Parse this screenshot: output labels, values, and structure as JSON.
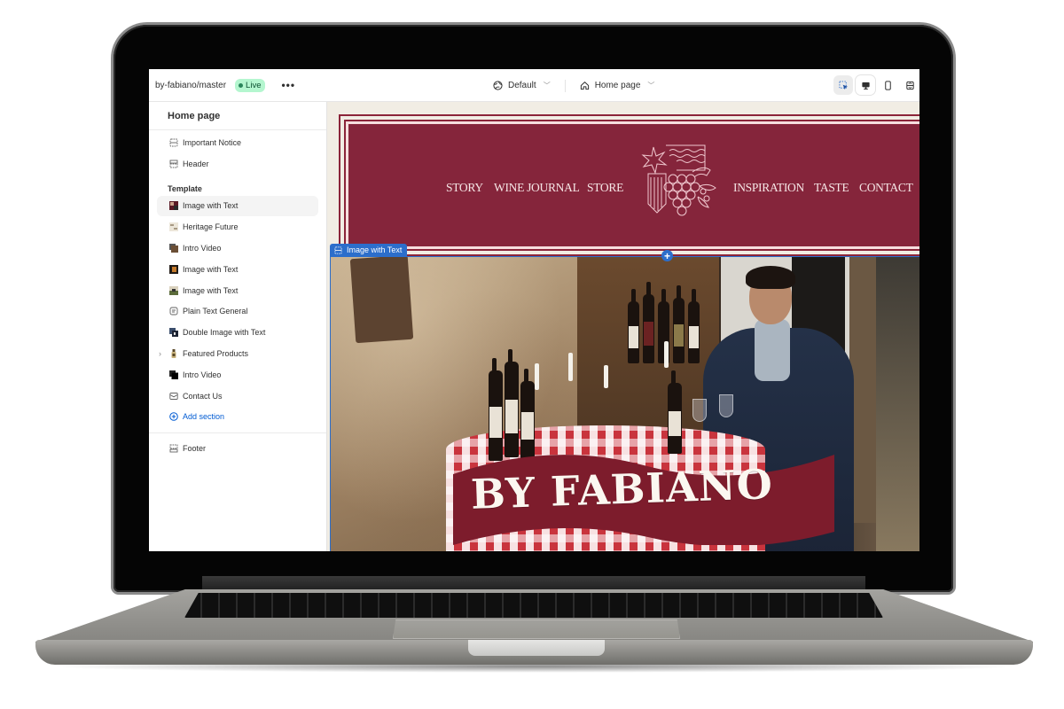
{
  "topbar": {
    "branch": "by-fabiano/master",
    "status_badge": "Live",
    "more_label": "•••",
    "theme_selector": {
      "value": "Default",
      "icon": "globe-icon"
    },
    "page_selector": {
      "value": "Home page",
      "icon": "home-icon"
    },
    "tools": [
      {
        "name": "inspector",
        "icon": "cursor-select-icon",
        "active": true
      },
      {
        "name": "desktop-view",
        "icon": "desktop-icon",
        "active": true
      },
      {
        "name": "mobile-view",
        "icon": "mobile-icon",
        "active": false
      },
      {
        "name": "fullscreen-view",
        "icon": "expand-icon",
        "active": false
      }
    ]
  },
  "sidebar": {
    "title": "Home page",
    "header_items": [
      {
        "label": "Important Notice",
        "icon": "section-icon"
      },
      {
        "label": "Header",
        "icon": "header-icon"
      }
    ],
    "template_label": "Template",
    "template_items": [
      {
        "label": "Image with Text",
        "icon": "thumbnail-icon",
        "selected": true
      },
      {
        "label": "Heritage Future",
        "icon": "thumbnail-icon"
      },
      {
        "label": "Intro Video",
        "icon": "video-icon"
      },
      {
        "label": "Image with Text",
        "icon": "thumbnail-icon"
      },
      {
        "label": "Image with Text",
        "icon": "thumbnail-icon"
      },
      {
        "label": "Plain Text General",
        "icon": "text-icon"
      },
      {
        "label": "Double Image with Text",
        "icon": "thumbnail-icon"
      },
      {
        "label": "Featured Products",
        "icon": "product-icon",
        "expandable": true
      },
      {
        "label": "Intro Video",
        "icon": "video-icon"
      },
      {
        "label": "Contact Us",
        "icon": "mail-icon"
      }
    ],
    "add_section_label": "Add section",
    "footer_items": [
      {
        "label": "Footer",
        "icon": "footer-icon"
      }
    ]
  },
  "preview": {
    "nav_left": [
      "STORY",
      "WINE JOURNAL",
      "STORE"
    ],
    "nav_right": [
      "INSPIRATION",
      "TASTE",
      "CONTACT"
    ],
    "selected_section_tag": "Image with Text",
    "hero_banner_text": "BY FABIANO",
    "colors": {
      "brand": "#85253b",
      "background": "#f1ede4",
      "accent": "#2c6ecb"
    }
  }
}
